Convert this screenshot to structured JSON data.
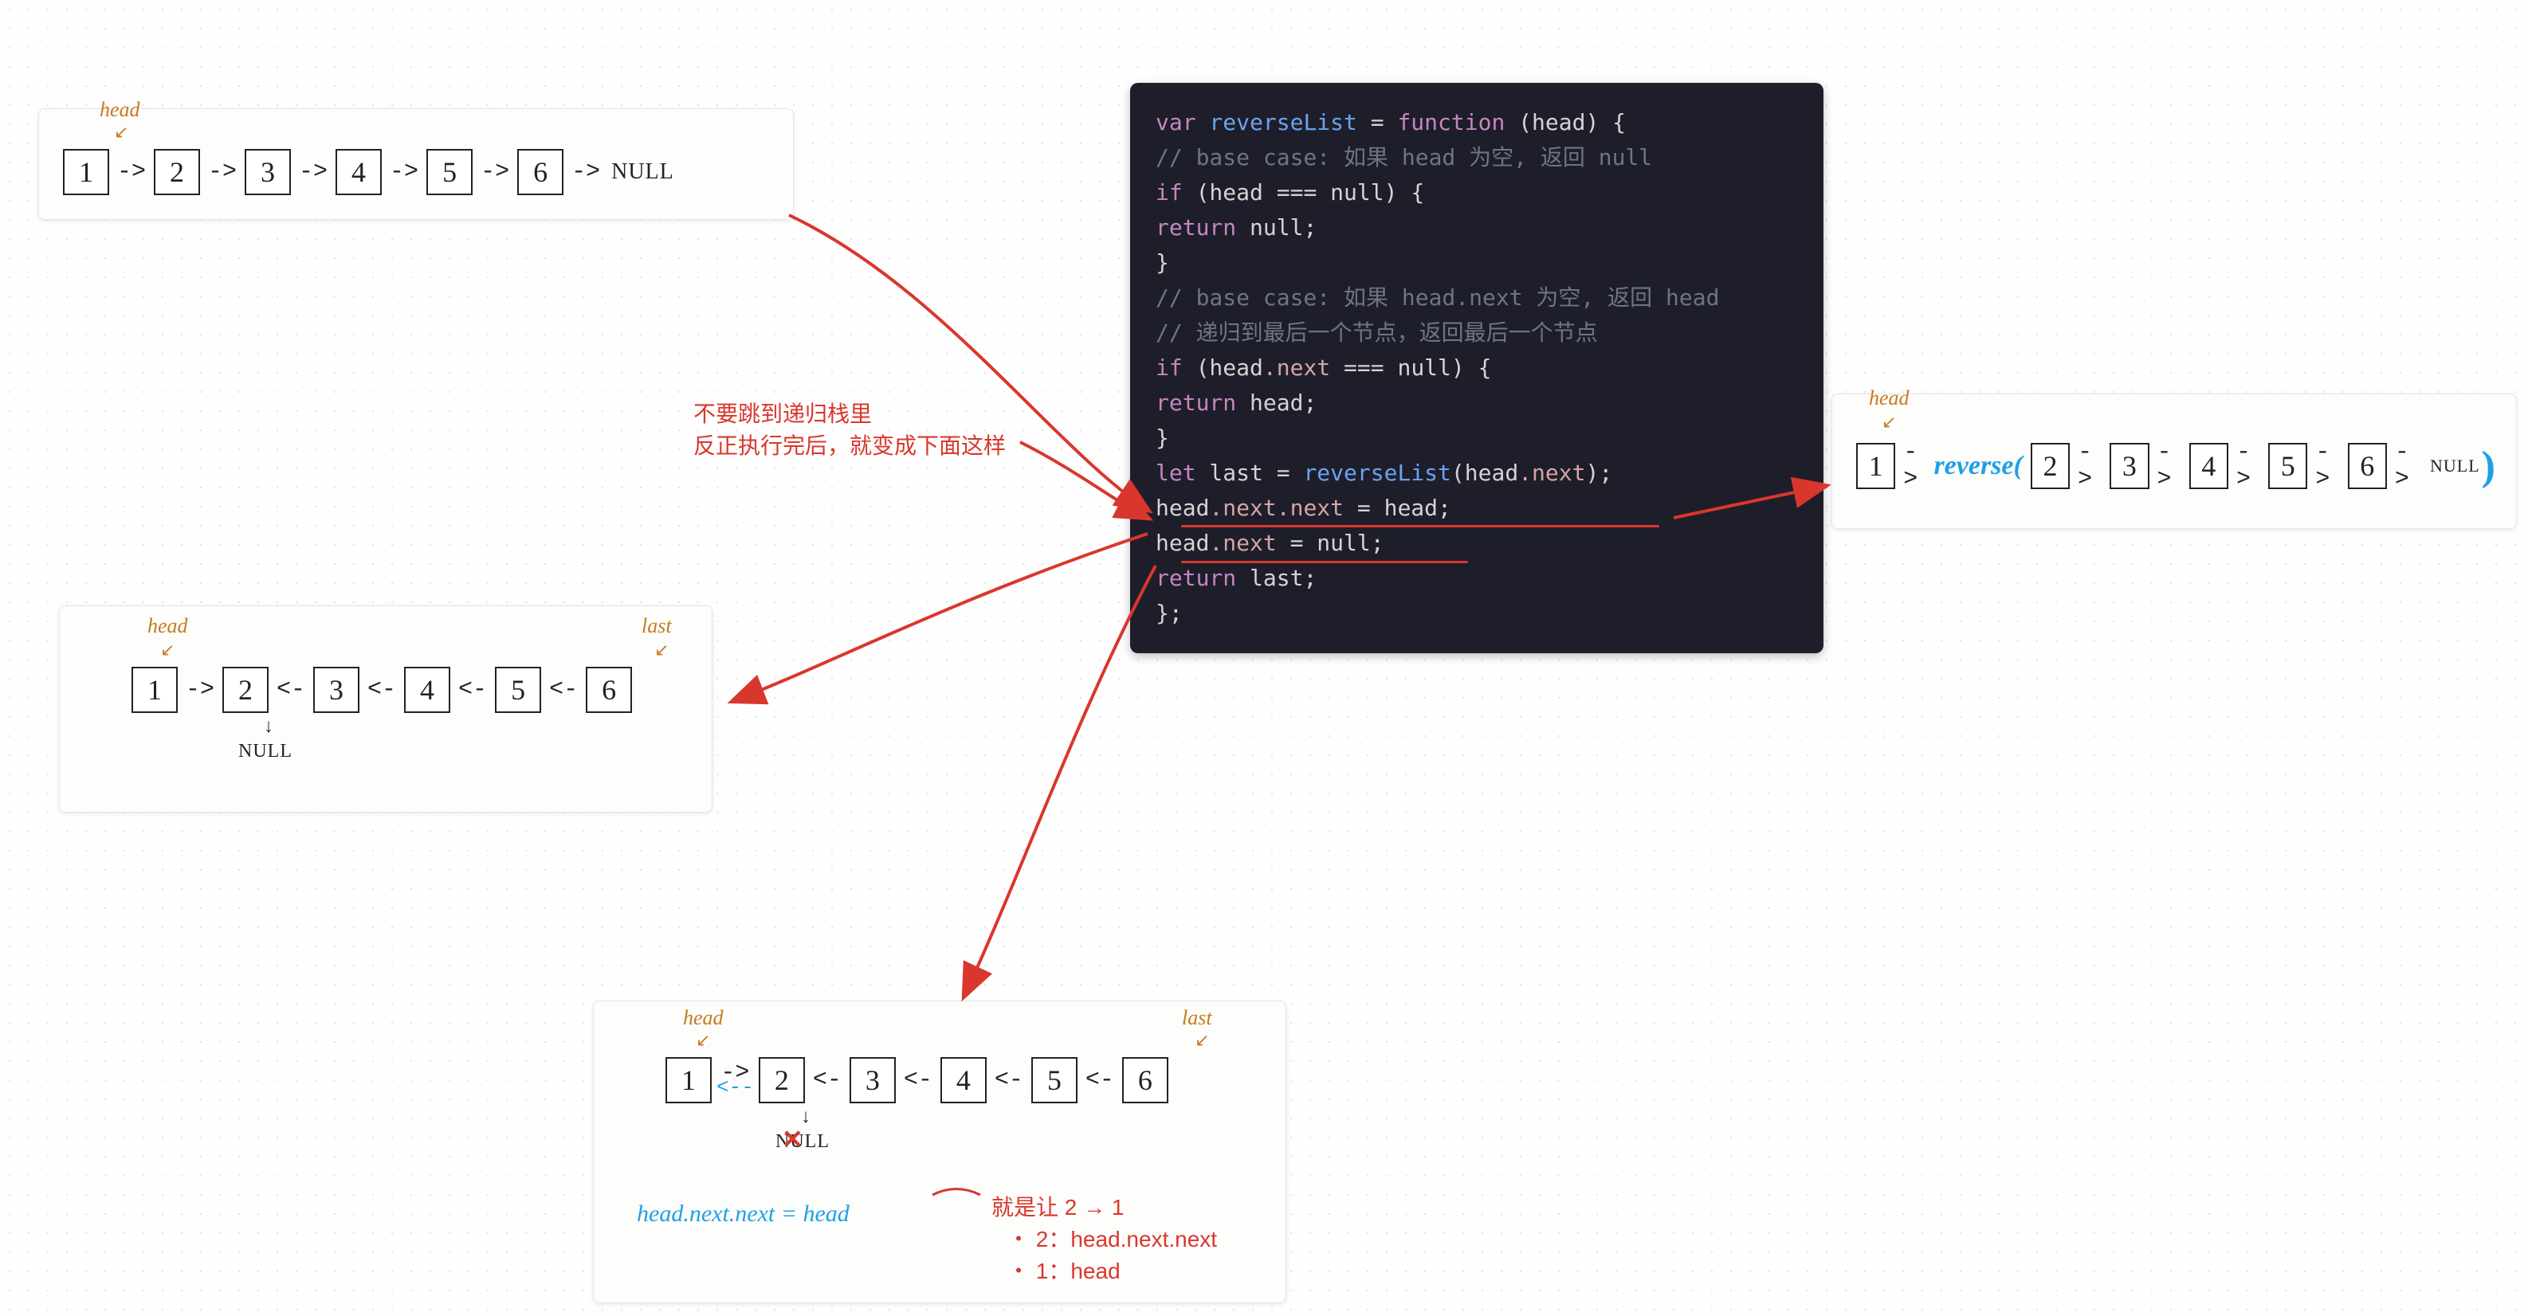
{
  "labels": {
    "head": "head",
    "last": "last",
    "null": "NULL",
    "reverse": "reverse(",
    "close_paren": ")"
  },
  "annotation1": {
    "line1": "不要跳到递归栈里",
    "line2": "反正执行完后，就变成下面这样"
  },
  "annotation2": {
    "caption": "head.next.next = head",
    "explain_title": "就是让 2 → 1",
    "bullet1": "・ 2：head.next.next",
    "bullet2": "・ 1：head"
  },
  "code": {
    "l1a": "var",
    "l1b": " reverseList ",
    "l1c": "=",
    "l1d": " function",
    "l1e": " (head) {",
    "l2": "  // base case: 如果 head 为空, 返回 null",
    "l3a": "  if",
    "l3b": " (head ",
    "l3c": "===",
    "l3d": " null) {",
    "l4a": "    return",
    "l4b": " null;",
    "l5": "  }",
    "l6": "  // base case: 如果 head.next 为空, 返回 head",
    "l7": "  // 递归到最后一个节点，返回最后一个节点",
    "l8a": "  if",
    "l8b": " (head",
    "l8c": ".next ",
    "l8d": "===",
    "l8e": " null) {",
    "l9a": "    return",
    "l9b": " head;",
    "l10": "  }",
    "l11": "",
    "l12a": "  let",
    "l12b": " last ",
    "l12c": "=",
    "l12d": " reverseList",
    "l12e": "(head",
    "l12f": ".next",
    "l12g": ");",
    "l13a": "  head",
    "l13b": ".next.next",
    "l13c": " = head;",
    "l14a": "  head",
    "l14b": ".next",
    "l14c": " = null;",
    "l15": "",
    "l16a": "  return",
    "l16b": " last;",
    "l17": "};"
  },
  "nodes": {
    "n1": "1",
    "n2": "2",
    "n3": "3",
    "n4": "4",
    "n5": "5",
    "n6": "6"
  },
  "arrows": {
    "fwd": "->",
    "back": "<-",
    "backblue": "<--",
    "both": "⇄",
    "down": "↓"
  }
}
